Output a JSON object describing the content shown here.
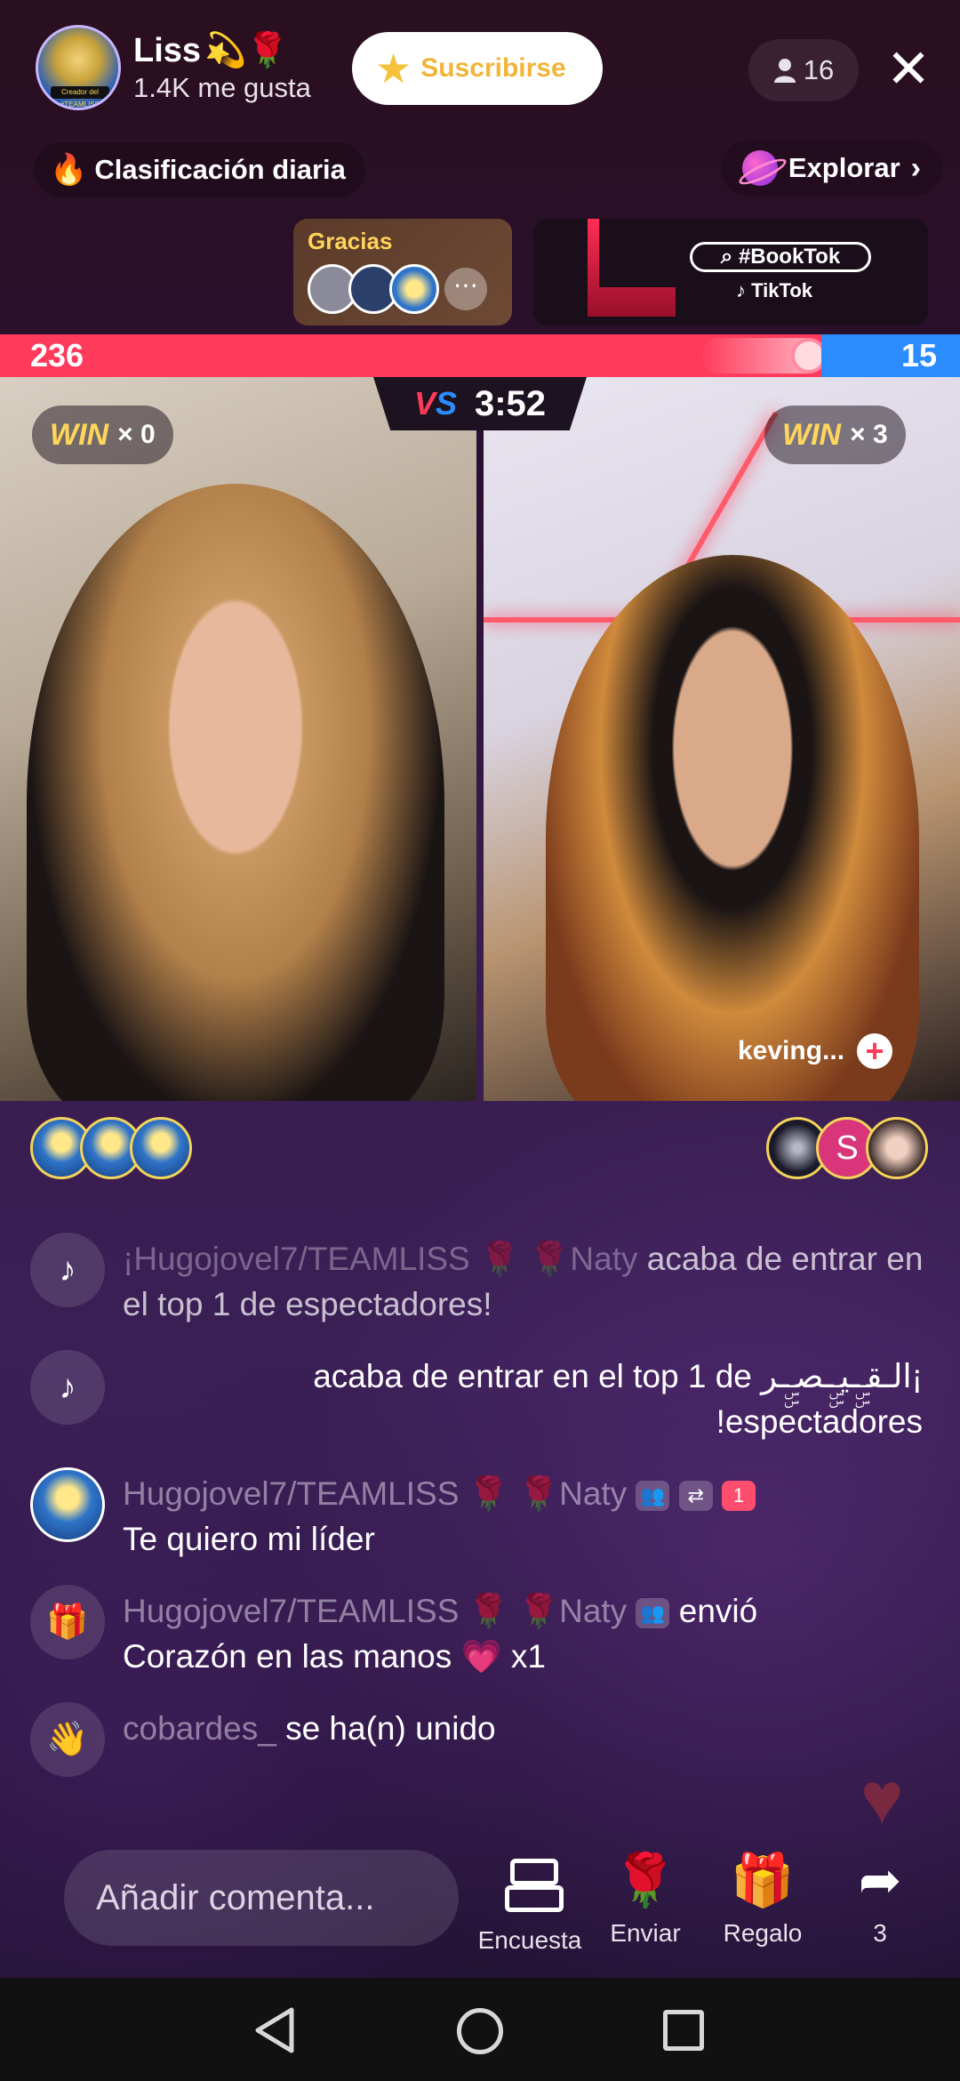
{
  "header": {
    "host_name": "Liss",
    "host_emoji": "💫🌹",
    "host_likes": "1.4K me gusta",
    "host_avatar_tag": "Creador del #TEAMLISS",
    "subscribe_label": "Suscribirse",
    "viewer_count": "16",
    "daily_rank_label": "Clasificación diaria",
    "explore_label": "Explorar"
  },
  "banners": {
    "thanks_title": "Gracias",
    "booktok_tag": "#BookTok",
    "booktok_brand": "TikTok"
  },
  "battle": {
    "score_left": "236",
    "score_right": "15",
    "timer": "3:52",
    "vs_label": "VS",
    "win_label": "WIN",
    "left_wins": "× 0",
    "right_wins": "× 3",
    "right_streamer": "keving..."
  },
  "supporters_right": {
    "letter": "S"
  },
  "chat": [
    {
      "user": "¡Hugojovel7/TEAMLISS 🌹 🌹Naty",
      "text": " acaba de entrar en el top 1 de espectadores!"
    },
    {
      "text_rtl": "¡الـقـۣۣـيـۣۣـصـۣۣـر acaba de entrar en el top 1 de espectadores!"
    },
    {
      "user": "Hugojovel7/TEAMLISS 🌹 🌹Naty",
      "text": "Te quiero mi líder",
      "badge_level": "1"
    },
    {
      "user": "Hugojovel7/TEAMLISS 🌹 🌹Naty",
      "action": " envió",
      "text": "Corazón en las manos 💗 x1"
    },
    {
      "user": "cobardes_",
      "text": " se ha(n) unido"
    }
  ],
  "bottom": {
    "comment_placeholder": "Añadir comenta...",
    "poll_label": "Encuesta",
    "send_label": "Enviar",
    "gift_label": "Regalo",
    "share_count": "3"
  },
  "colors": {
    "score_red": "#ff3b5c",
    "score_blue": "#2b8cff",
    "subscribe_text": "#f0b53a",
    "win_yellow": "#ffd65c"
  }
}
